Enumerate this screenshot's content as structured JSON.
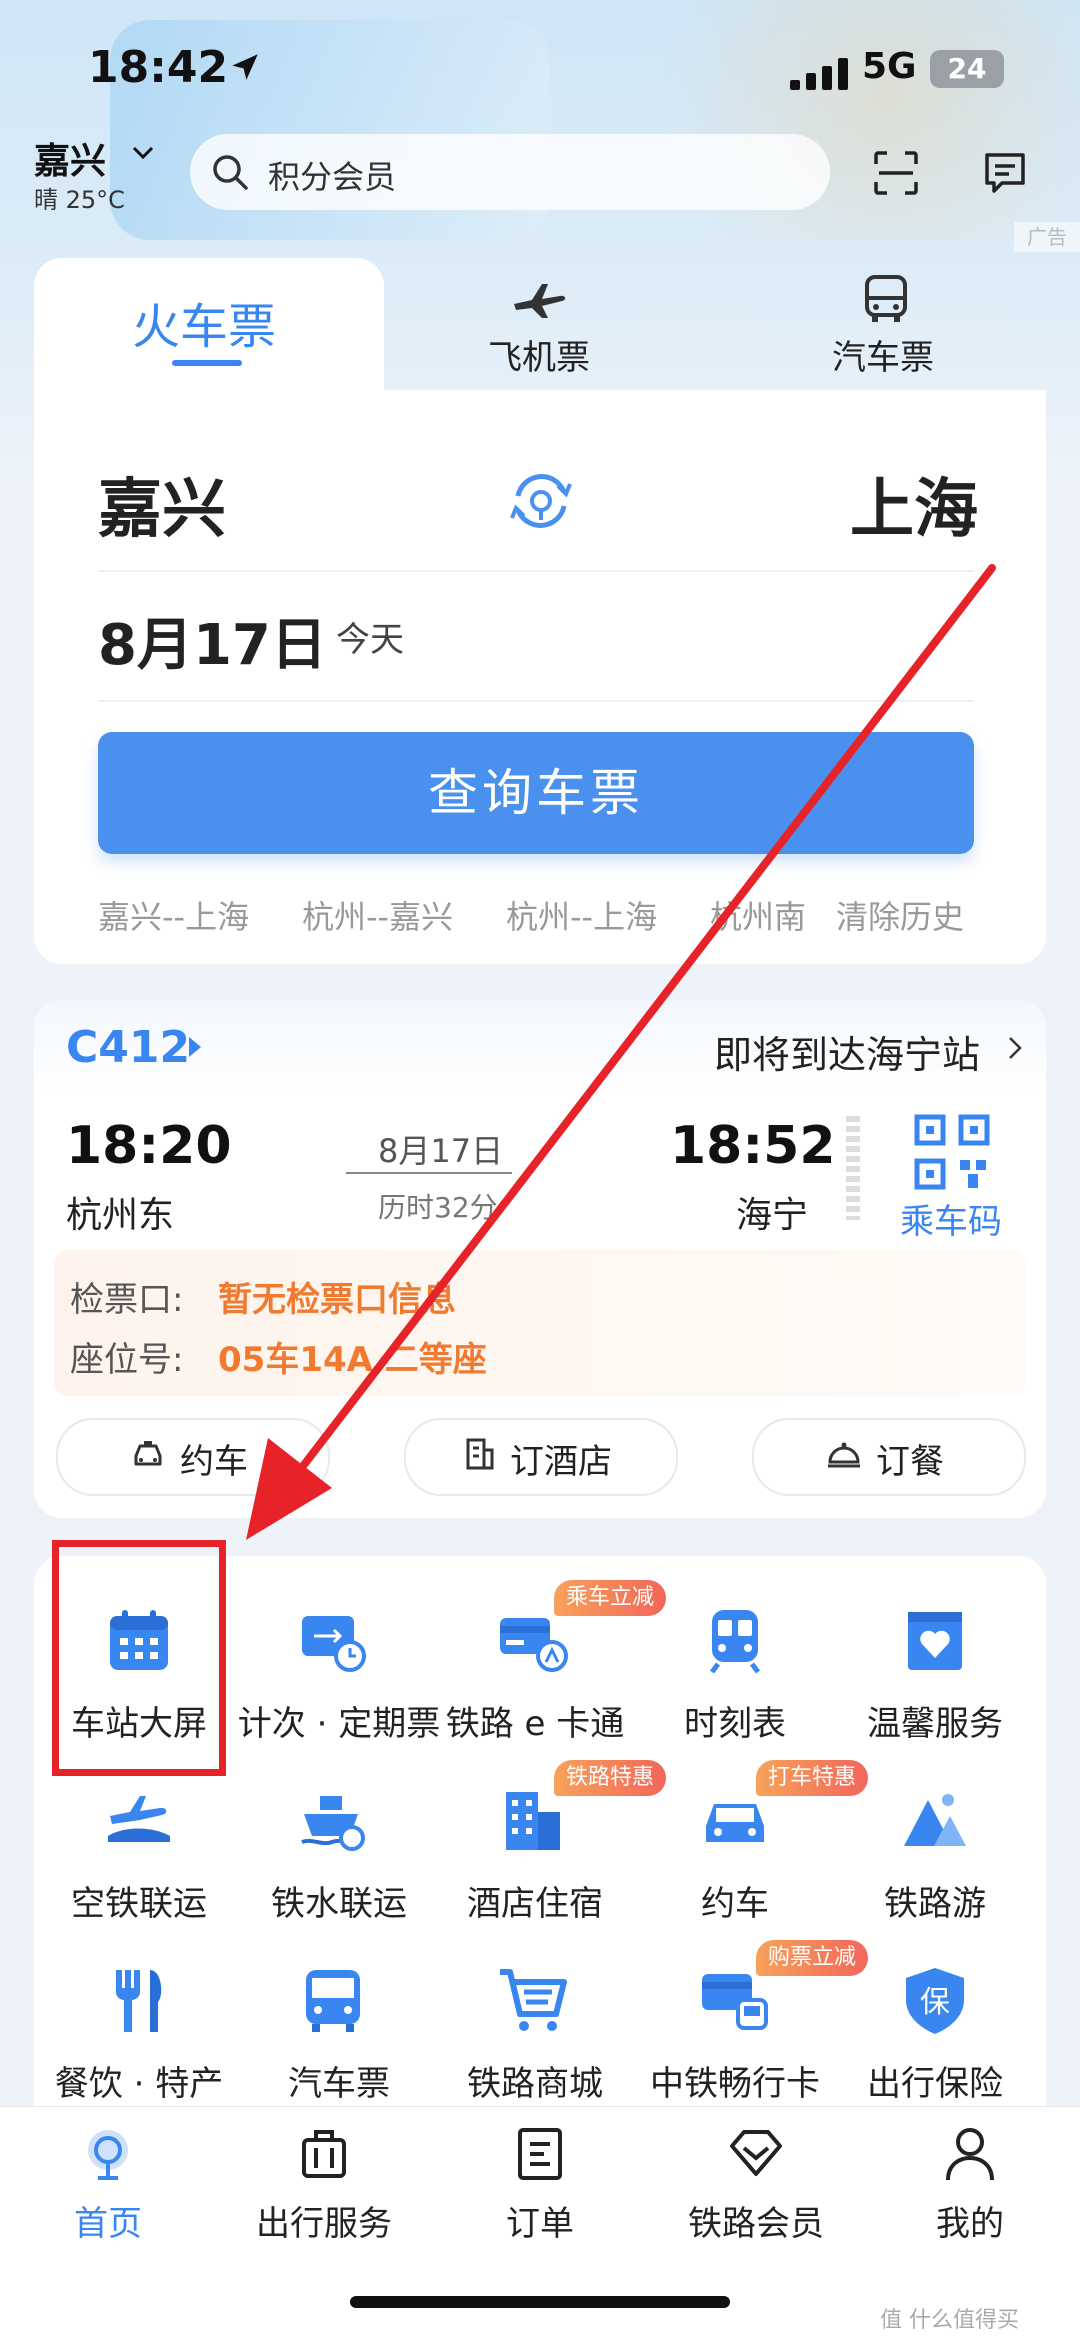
{
  "status_bar": {
    "time": "18:42",
    "network": "5G",
    "battery": "24"
  },
  "header": {
    "city": "嘉兴",
    "weather": "晴 25°C",
    "search_placeholder": "积分会员",
    "ad_label": "广告"
  },
  "ticket_tabs": [
    {
      "label": "火车票",
      "active": true
    },
    {
      "label": "飞机票",
      "icon": "plane-icon"
    },
    {
      "label": "汽车票",
      "icon": "bus-icon"
    }
  ],
  "ticket_form": {
    "from_city": "嘉兴",
    "to_city": "上海",
    "date": "8月17日",
    "date_note": "今天",
    "query_button": "查询车票",
    "history": [
      "嘉兴--上海",
      "杭州--嘉兴",
      "杭州--上海",
      "杭州南",
      "清除历史"
    ]
  },
  "trip": {
    "train_no": "C412",
    "arrival_notice": "即将到达海宁站",
    "dep_time": "18:20",
    "dep_station": "杭州东",
    "date": "8月17日",
    "duration": "历时32分",
    "arr_time": "18:52",
    "arr_station": "海宁",
    "qr_label": "乘车码",
    "gate_key": "检票口:",
    "gate_value": "暂无检票口信息",
    "seat_key": "座位号:",
    "seat_value": "05车14A 二等座",
    "actions": [
      {
        "label": "约车",
        "icon": "taxi-icon"
      },
      {
        "label": "订酒店",
        "icon": "hotel-icon"
      },
      {
        "label": "订餐",
        "icon": "dining-icon"
      }
    ]
  },
  "services": [
    {
      "label": "车站大屏",
      "icon": "calendar-icon"
    },
    {
      "label": "计次 · 定期票",
      "icon": "ticket-card-icon"
    },
    {
      "label": "铁路 e 卡通",
      "icon": "ecard-icon",
      "badge": "乘车立减"
    },
    {
      "label": "时刻表",
      "icon": "train-front-icon"
    },
    {
      "label": "温馨服务",
      "icon": "heart-box-icon"
    },
    {
      "label": "空铁联运",
      "icon": "plane-train-icon"
    },
    {
      "label": "铁水联运",
      "icon": "ship-icon"
    },
    {
      "label": "酒店住宿",
      "icon": "building-icon",
      "badge": "铁路特惠"
    },
    {
      "label": "约车",
      "icon": "car-icon",
      "badge": "打车特惠"
    },
    {
      "label": "铁路游",
      "icon": "mountain-icon"
    },
    {
      "label": "餐饮 · 特产",
      "icon": "fork-knife-icon"
    },
    {
      "label": "汽车票",
      "icon": "bus-icon"
    },
    {
      "label": "铁路商城",
      "icon": "cart-icon"
    },
    {
      "label": "中铁畅行卡",
      "icon": "card-train-icon",
      "badge": "购票立减"
    },
    {
      "label": "出行保险",
      "icon": "shield-icon",
      "badge_text": "保"
    }
  ],
  "bottom_nav": [
    {
      "label": "首页",
      "active": true
    },
    {
      "label": "出行服务"
    },
    {
      "label": "订单"
    },
    {
      "label": "铁路会员"
    },
    {
      "label": "我的"
    }
  ],
  "watermark": "值 什么值得买",
  "colors": {
    "accent": "#3a86f0",
    "button": "#4a90ef",
    "warning": "#f07a30",
    "highlight": "#e7232a"
  }
}
